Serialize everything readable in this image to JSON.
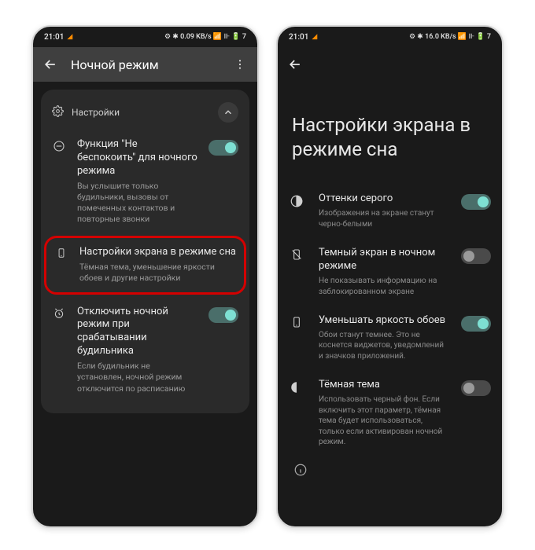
{
  "left": {
    "status": {
      "time": "21:01",
      "indicators": "⚙ ✱ 0.09 KB/s 📶 ⊪ 🔋 7"
    },
    "toolbar": {
      "title": "Ночной режим"
    },
    "card_header": "Настройки",
    "items": [
      {
        "title": "Функция \"Не беспокоить\" для ночного режима",
        "sub": "Вы услышите только будильники, вызовы от помеченных контактов и повторные звонки",
        "toggle": true
      },
      {
        "title": "Настройки экрана в режиме сна",
        "sub": "Тёмная тема, уменьшение яркости обоев и другие настройки",
        "highlighted": true
      },
      {
        "title": "Отключить ночной режим при срабатывании будильника",
        "sub": "Если будильник не установлен, ночной режим отключится по расписанию",
        "toggle": true
      }
    ]
  },
  "right": {
    "status": {
      "time": "21:01",
      "indicators": "⚙ ✱ 16.0 KB/s 📶 ⊪ 🔋 7"
    },
    "page_title": "Настройки экрана в режиме сна",
    "items": [
      {
        "title": "Оттенки серого",
        "sub": "Изображения на экране станут черно-белыми",
        "toggle": true
      },
      {
        "title": "Темный экран в ночном режиме",
        "sub": "Не показывать информацию на заблокированном экране",
        "toggle": false
      },
      {
        "title": "Уменьшать яркость обоев",
        "sub": "Обои станут темнее. Это не коснется виджетов, уведомлений и значков приложений.",
        "toggle": true
      },
      {
        "title": "Тёмная тема",
        "sub": "Использовать черный фон. Если включить этот параметр, тёмная тема будет использоваться, только если активирован ночной режим.",
        "toggle": false
      }
    ]
  }
}
